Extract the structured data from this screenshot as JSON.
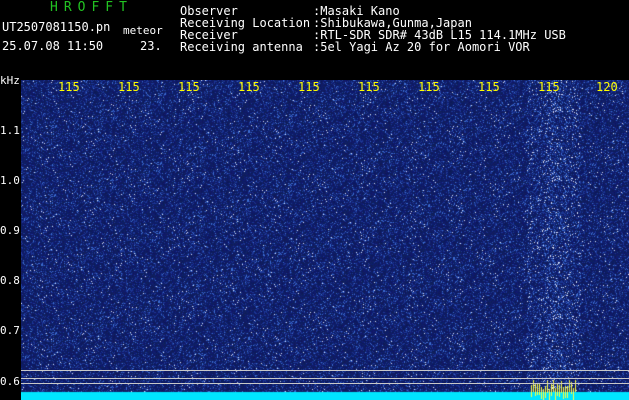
{
  "header": {
    "logo": "HROFFT",
    "filename": "UT2507081150.pn",
    "filename_suffix": "meteor",
    "datetime": "25.07.08 11:50",
    "datetime_num": "23.",
    "rows": [
      {
        "label": "Observer",
        "value": ":Masaki Kano"
      },
      {
        "label": "Receiving Location",
        "value": ":Shibukawa,Gunma,Japan"
      },
      {
        "label": "Receiver",
        "value": ":RTL-SDR SDR# 43dB L15 114.1MHz USB"
      },
      {
        "label": "Receiving antenna",
        "value": ":5el Yagi Az 20 for Aomori VOR"
      }
    ]
  },
  "axes": {
    "y_unit": "kHz",
    "y_ticks": [
      "1.1",
      "1.0",
      "0.9",
      "0.8",
      "0.7",
      "0.6"
    ],
    "x_ticks": [
      "115",
      "115",
      "115",
      "115",
      "115",
      "115",
      "115",
      "115",
      "115",
      "120"
    ]
  },
  "colors": {
    "background": "#000000",
    "plot": "#0e1d6c",
    "logo": "#22c322",
    "tick_x": "#ffff00",
    "bottom_band": "#00e5ff"
  }
}
